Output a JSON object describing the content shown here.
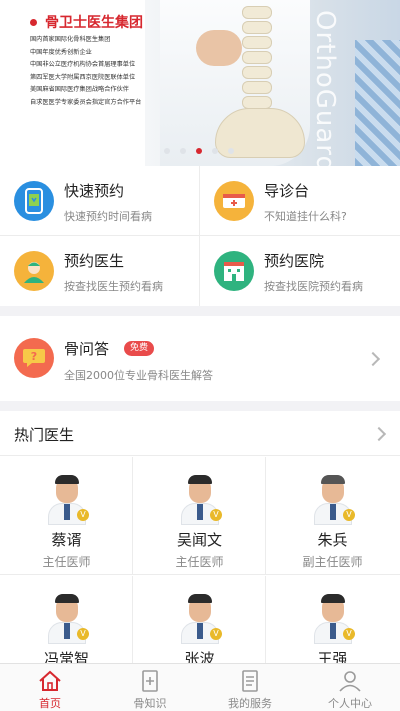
{
  "banner": {
    "brand": "骨卫士医生集团",
    "lines": [
      "国内首家国际化骨科医生集团",
      "中国年度优秀创新企业",
      "中国非公立医疗机构协会首届理事单位",
      "第四军医大学附属西京医院医联体单位",
      "美国麻省国际医疗集团战略合作伙伴",
      "自求医医学专家委员会指定官方合作平台"
    ],
    "watermark": "OrthoGuard",
    "slides": 5,
    "active_slide": 3
  },
  "quick": [
    {
      "title": "快速预约",
      "sub": "快速预约时间看病",
      "icon": "phone-calendar-icon",
      "color": "#2a8fe0"
    },
    {
      "title": "导诊台",
      "sub": "不知道挂什么科?",
      "icon": "hospital-bed-icon",
      "color": "#f5b33b"
    },
    {
      "title": "预约医生",
      "sub": "按查找医生预约看病",
      "icon": "doctor-icon",
      "color": "#f5b33b"
    },
    {
      "title": "预约医院",
      "sub": "按查找医院预约看病",
      "icon": "hospital-icon",
      "color": "#2fb37f"
    }
  ],
  "qa": {
    "title": "骨问答",
    "badge": "免费",
    "sub": "全国2000位专业骨科医生解答"
  },
  "hot": {
    "title": "热门医生",
    "doctors": [
      {
        "name": "蔡谞",
        "title": "主任医师"
      },
      {
        "name": "吴闻文",
        "title": "主任医师"
      },
      {
        "name": "朱兵",
        "title": "副主任医师"
      },
      {
        "name": "冯常智",
        "title": ""
      },
      {
        "name": "张波",
        "title": ""
      },
      {
        "name": "王强",
        "title": ""
      }
    ],
    "verified": "V"
  },
  "tabs": [
    {
      "label": "首页",
      "icon": "home-icon",
      "active": true
    },
    {
      "label": "骨知识",
      "icon": "knowledge-icon",
      "active": false
    },
    {
      "label": "我的服务",
      "icon": "service-icon",
      "active": false
    },
    {
      "label": "个人中心",
      "icon": "user-icon",
      "active": false
    }
  ],
  "colors": {
    "accent": "#d7282f",
    "qa_icon": "#f36a4f",
    "badge": "#e94b4b"
  }
}
